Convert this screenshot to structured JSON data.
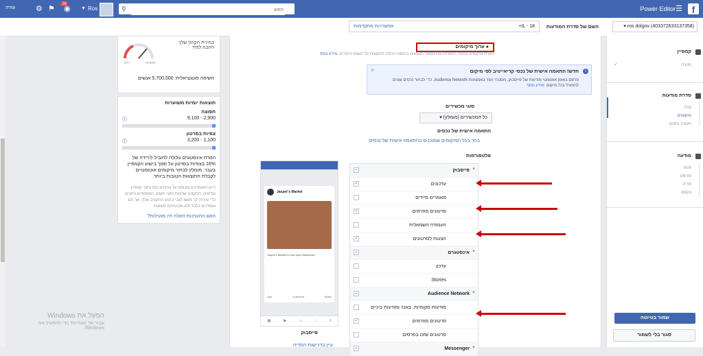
{
  "topbar": {
    "app_title": "Power Editor",
    "help_label": "עזרה",
    "notification_count": "26",
    "user_name": "Ros",
    "search_placeholder": "חפש",
    "facebook_logo": "f"
  },
  "subbar": {
    "account": "(ros dolgov (403372633137358",
    "adset_name_label": "השם של סדרת המודעות",
    "adset_name_value": "IL - 18+",
    "advanced_options": "אפשרויות מתקדמות"
  },
  "audience": {
    "gauge_desc": "בחירת הקהל שלך רחבה לפיד",
    "gauge_low": "ספציפי",
    "gauge_high": "רחב",
    "potential_reach": "חשיפה פוטנציאלית: 5,700,000 אנשים"
  },
  "estimates": {
    "title": "תוצאות יומיות משוערות",
    "reach_label": "תפוצה",
    "reach_value": "2,900 - 9,100",
    "video_label": "צפיות בסרטון",
    "video_value": "1,100 - 3,200",
    "note": "הסרת אינסטגרם עלולה להוביל לירידה של 16% בצפיות בסרטון על סמך בישוע הקמפיין בעבר. מומלץ לבחור מיקומים אוטומטיים לקבלת התוצאות הטובות ביותר.",
    "tip": "דיוק האומדנים מבוסס על גורמים כמו נתוני קמפיין קודמים, התקציב שהזנת ותוני השוק. המספרים ניתנים כדי שיהיה לך מושג לגבי ביצוע התקציב שלך, אך הם אומדנים בלבד ולא מבטיחים תוצאות.",
    "link": "האם ההערכות האלה היו מועילות?"
  },
  "placements": {
    "title": "ערוך מיקומים",
    "desc": "הסרת מיקומים עלולה להפחית את מספר האנשים בהפצה ויכולה להקשות על השגת היעדים.",
    "desc_link": "מידע נוסף",
    "info_title": "חדש! התאמה אישית של נכסי קריאייטיב לפי מיקום",
    "info_desc": "פרסם באופן אוטומטי מודעות של פייסבוק, מסנג'ר ועוד באמצעות Audience Network. כדי לבחור נכסים שונים להפעיל בכל מיקום.",
    "info_link": "מידע נוסף",
    "devices_label": "סוגי מכשירים",
    "devices_value": "כל המכשירים (מומלץ)",
    "match_label": "התאמה אישית של נכסים",
    "match_link": "בחר בכל המיקומים שמוכנים בהתאמה אישית של נכסים",
    "platforms_label": "פלטפורמות",
    "rows": [
      {
        "label": "פייסבוק",
        "group": true,
        "checked": false
      },
      {
        "label": "עדכונים",
        "group": false,
        "checked": true
      },
      {
        "label": "מאמרים מיידים",
        "group": false,
        "checked": false
      },
      {
        "label": "סרטונים מוזרמים",
        "group": false,
        "checked": true
      },
      {
        "label": "העמודה השמאלית",
        "group": false,
        "checked": false
      },
      {
        "label": "הצעות לסרטונים",
        "group": false,
        "checked": true
      },
      {
        "label": "אינסטגרם",
        "group": true,
        "checked": false
      },
      {
        "label": "עדכון",
        "group": false,
        "checked": false
      },
      {
        "label": "Stories",
        "group": false,
        "checked": false
      },
      {
        "label": "Audience Network",
        "group": true,
        "checked": false
      },
      {
        "label": "מודעות מקומיות, באנר ומודעות ביניים",
        "group": false,
        "checked": false
      },
      {
        "label": "סרטונים מוזרמים",
        "group": false,
        "checked": true
      },
      {
        "label": "סרטונים שזכו בפרסים",
        "group": false,
        "checked": false
      },
      {
        "label": "Messenger",
        "group": true,
        "checked": false
      }
    ]
  },
  "preview": {
    "brand": "Jasper's Market",
    "caption": "Jasper's Market is now open downtown",
    "like": "Like",
    "comment": "Comment",
    "share": "Share",
    "label": "פייסבוק",
    "link": "עיין בדרישות המדיה"
  },
  "nav": {
    "campaign": "קמפיין",
    "campaign_sub": "מטרה",
    "adset": "סדרת מודעות",
    "adset_items": [
      "קהל",
      "מיקומים",
      "תקציב ותזמון"
    ],
    "ad": "מודעה",
    "ad_items": [
      "זהות",
      "פורמט",
      "מדיה",
      "טקסט"
    ],
    "save_draft": "שמור בטיוטה",
    "close_no_save": "סגור בלי לשמור"
  },
  "watermark": {
    "line1": "הפעל את Windows",
    "line2": "עבור אל 'הגדרות' כדי להפעיל את Windows."
  }
}
